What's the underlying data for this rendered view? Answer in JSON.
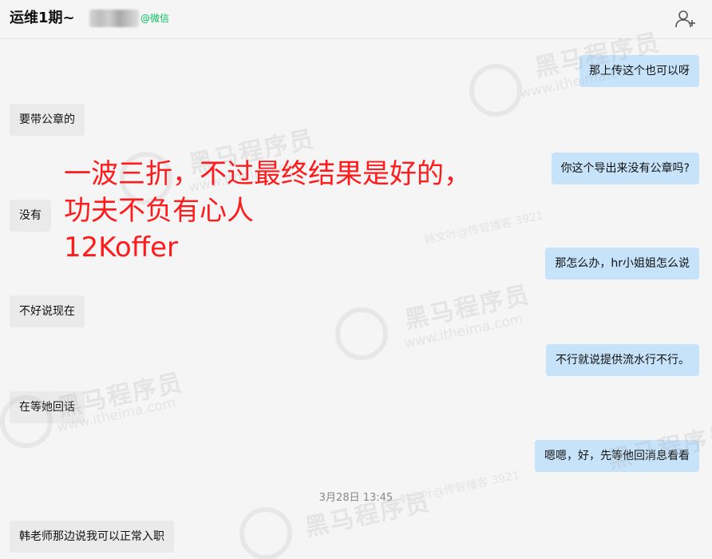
{
  "header": {
    "title": "运维1期~",
    "name_suffix": "@微信",
    "add_member_icon": "add-person-icon"
  },
  "messages": [
    {
      "side": "out",
      "text": "那上传这个也可以呀"
    },
    {
      "side": "in",
      "text": "要带公章的"
    },
    {
      "side": "out",
      "text": "你这个导出来没有公章吗?"
    },
    {
      "side": "in",
      "text": "没有"
    },
    {
      "side": "out",
      "text": "那怎么办，hr小姐姐怎么说"
    },
    {
      "side": "in",
      "text": "不好说现在"
    },
    {
      "side": "out",
      "text": "不行就说提供流水行不行。"
    },
    {
      "side": "in",
      "text": "在等她回话"
    },
    {
      "side": "out",
      "text": "嗯嗯，好，先等他回消息看看"
    },
    {
      "side": "in",
      "text": "韩老师那边说我可以正常入职"
    }
  ],
  "timestamp": "3月28日 13:45",
  "overlay": {
    "line1": "一波三折，不过最终结果是好的，",
    "line2": "功夫不负有心人",
    "line3": "12Koffer",
    "color": "#ff1b1b"
  },
  "watermark": {
    "brand": "黑马程序员",
    "url": "www.itheima.com",
    "tag": "韩文叶@传智播客 3921"
  },
  "colors": {
    "incoming_bubble": "#eaeaea",
    "outgoing_bubble": "#c6e3fa",
    "wechat_green": "#07c160"
  }
}
